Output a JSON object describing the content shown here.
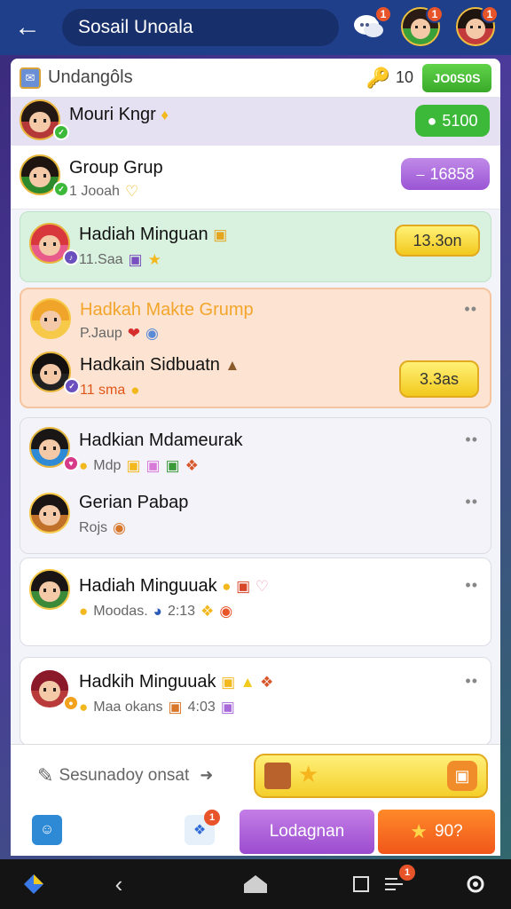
{
  "topbar": {
    "title": "Sosail Unoala",
    "badges": [
      "1",
      "1",
      "1"
    ]
  },
  "panel": {
    "title": "Undangôls",
    "count": "10",
    "button_label": "JO0S0S"
  },
  "rows": [
    {
      "name": "Mouri Kngr",
      "pill": "5100",
      "pill_color": "#3db93a"
    },
    {
      "name": "Group Grup",
      "sub": "1 Jooah",
      "pill": "16858",
      "pill_color": "#a05fd8"
    },
    {
      "name": "Hadiah Minguan",
      "sub": "11.Saa",
      "pill": "13.3on",
      "pill_color": "#f2c91d"
    },
    {
      "name": "Hadkah Makte Grump",
      "sub": "P.Jaup"
    },
    {
      "name": "Hadkain Sidbuatn",
      "sub": "11 sma",
      "pill": "3.3as",
      "pill_color": "#f2c91d"
    },
    {
      "name": "Hadkian Mdameurak",
      "sub": "Mdp"
    },
    {
      "name": "Gerian Pabap",
      "sub": "Rojs"
    },
    {
      "name": "Hadiah Minguuak",
      "sub": "Moodas.",
      "sub_extra": "2:13"
    },
    {
      "name": "Hadkih Minguuak",
      "sub": "Maa okans",
      "sub_extra": "4:03"
    }
  ],
  "composer": {
    "placeholder": "Sesunadoy onsat"
  },
  "actions": {
    "badge": "1",
    "purple_label": "Lodagnan",
    "orange_label": "90?"
  },
  "sysnav": {
    "badge": "1"
  },
  "colors": {
    "topbar": "#1f3f8a",
    "accent_green": "#3db93a",
    "accent_purple": "#a05fd8",
    "accent_yellow": "#f2c91d",
    "accent_orange": "#f0561a"
  }
}
